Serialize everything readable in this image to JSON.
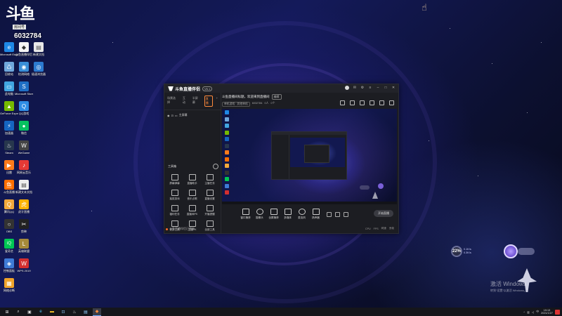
{
  "streamer": {
    "platform_logo": "斗鱼",
    "room_label": "房间号",
    "room_id": "6032784"
  },
  "desktop_icons": [
    {
      "label": "Microsoft Edge",
      "color": "#1e88e5",
      "glyph": "e"
    },
    {
      "label": "斗鱼直播伴侣",
      "color": "#f5f5f5",
      "glyph": "◆"
    },
    {
      "label": "新建文档",
      "color": "#e8e8e8",
      "glyph": "▤"
    },
    {
      "label": "回收站",
      "color": "#6fa8dc",
      "glyph": "♺"
    },
    {
      "label": "检测网络",
      "color": "#3a8fd8",
      "glyph": "◉"
    },
    {
      "label": "极速浏览器",
      "color": "#2c7bd0",
      "glyph": "◎"
    },
    {
      "label": "此电脑",
      "color": "#41a5e0",
      "glyph": "▭"
    },
    {
      "label": "Microsoft Store",
      "color": "#1f6fc5",
      "glyph": "S"
    },
    {
      "label": "GeForce Experience",
      "color": "#76b900",
      "glyph": "▲"
    },
    {
      "label": "QQ游戏",
      "color": "#2f8de4",
      "glyph": "Q"
    },
    {
      "label": "加速器",
      "color": "#1565c0",
      "glyph": "⚡"
    },
    {
      "label": "微信",
      "color": "#07c160",
      "glyph": "●"
    },
    {
      "label": "Steam",
      "color": "#27374d",
      "glyph": "♨"
    },
    {
      "label": "WeGame",
      "color": "#444",
      "glyph": "W"
    },
    {
      "label": "迅雷",
      "color": "#ff7a1a",
      "glyph": "▶"
    },
    {
      "label": "网易云音乐",
      "color": "#e53935",
      "glyph": "♪"
    },
    {
      "label": "斗鱼直播",
      "color": "#ff6f00",
      "glyph": "鱼"
    },
    {
      "label": "新建文本文档",
      "color": "#eeeeee",
      "glyph": "▤"
    },
    {
      "label": "腾讯QQ",
      "color": "#f2a93b",
      "glyph": "Q"
    },
    {
      "label": "虎牙直播",
      "color": "#ffb300",
      "glyph": "虎"
    },
    {
      "label": "OBS",
      "color": "#333",
      "glyph": "○"
    },
    {
      "label": "剪映",
      "color": "#222",
      "glyph": "✂"
    },
    {
      "label": "爱奇艺",
      "color": "#00c853",
      "glyph": "iQ"
    },
    {
      "label": "英雄联盟",
      "color": "#a58a3a",
      "glyph": "L"
    },
    {
      "label": "控制面板",
      "color": "#3e7bd6",
      "glyph": "◈"
    },
    {
      "label": "WPS 2019",
      "color": "#d32f2f",
      "glyph": "W"
    },
    {
      "label": "网络诊断",
      "color": "#f0a32a",
      "glyph": "▦"
    }
  ],
  "app_window": {
    "app_name": "斗鱼直播伴侣",
    "version": "V6.1",
    "tabs": [
      {
        "label": "场景选择",
        "active": false
      },
      {
        "label": "互动",
        "active": false
      },
      {
        "label": "半屏幕",
        "active": false
      },
      {
        "label": "直播",
        "active": true
      }
    ],
    "scene_name": "主屏幕",
    "toolbox_title": "工具箱",
    "tools": [
      {
        "label": "屏幕弹幕"
      },
      {
        "label": "直播助手"
      },
      {
        "label": "主播任务"
      },
      {
        "label": "抽奖游戏"
      },
      {
        "label": "音乐点歌"
      },
      {
        "label": "直播设置"
      },
      {
        "label": "福利任务"
      },
      {
        "label": "直播间PK"
      },
      {
        "label": "开播提醒"
      },
      {
        "label": "更多工具"
      },
      {
        "label": "主播PK"
      },
      {
        "label": "全部工具"
      }
    ],
    "notice": "斗鱼直播伴侣已更新",
    "room_title": "斗鱼直播间标题，欢迎来到直播间",
    "edit_label": "编辑",
    "room_meta": [
      "单机游戏 · 其他单机",
      "6032784",
      "0人",
      "0个"
    ],
    "controls": [
      {
        "label": "窗口捕获"
      },
      {
        "label": "摄像头"
      },
      {
        "label": "全屏捕获"
      },
      {
        "label": "多媒体"
      },
      {
        "label": "麦克风"
      },
      {
        "label": "扬声器"
      }
    ],
    "live_button": "开始直播",
    "status": [
      "CPU",
      "FPS",
      "网速",
      "丢帧"
    ]
  },
  "widgets": {
    "net_monitor_value": "22%",
    "net_up": "0.1K/s",
    "net_down": "0.3K/s"
  },
  "activate_windows": {
    "title": "激活 Windows",
    "subtitle": "转到“设置”以激活 Windows。"
  },
  "taskbar": {
    "tray_lang": "中",
    "clock_time": "19:13",
    "clock_date": "2021/1/27"
  }
}
